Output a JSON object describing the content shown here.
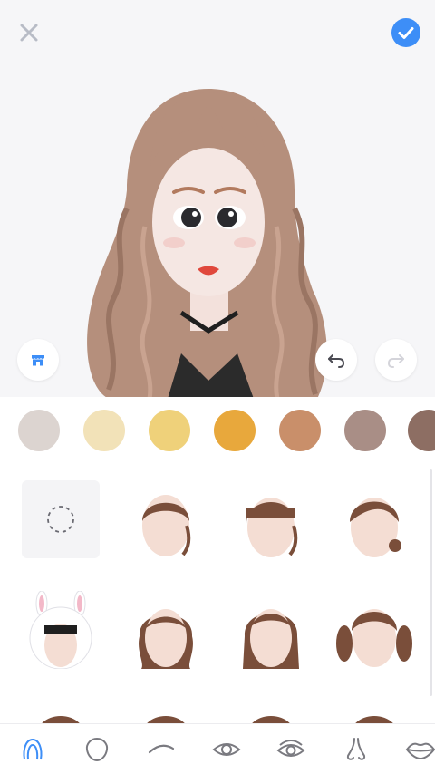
{
  "toolbar": {
    "close_icon": "close-icon",
    "confirm_icon": "check-circle-icon",
    "store_icon": "store-icon",
    "undo_icon": "undo-icon",
    "redo_icon": "redo-icon"
  },
  "avatar": {
    "description_icon": "avatar-preview"
  },
  "colors": {
    "accent": "#3d8ef7",
    "selected_tab": "#3d8ef7",
    "tab_icon": "#7a7a80"
  },
  "hair_colors": [
    "#dcd4d0",
    "#f2e2b8",
    "#efd17a",
    "#e8a83c",
    "#c98f6a",
    "#a98e86",
    "#8d6e63"
  ],
  "hair_styles": [
    "none",
    "bun-top",
    "bangs-bun",
    "side-part-bun",
    "bunny-hat",
    "long-wavy",
    "long-straight",
    "pigtails",
    "style-9",
    "style-10",
    "style-11",
    "style-12"
  ],
  "tabs": [
    {
      "icon": "hair-icon",
      "selected": true
    },
    {
      "icon": "face-shape-icon",
      "selected": false
    },
    {
      "icon": "eyebrow-icon",
      "selected": false
    },
    {
      "icon": "eye-icon",
      "selected": false
    },
    {
      "icon": "eye-detail-icon",
      "selected": false
    },
    {
      "icon": "nose-icon",
      "selected": false
    },
    {
      "icon": "lips-icon",
      "selected": false
    }
  ]
}
